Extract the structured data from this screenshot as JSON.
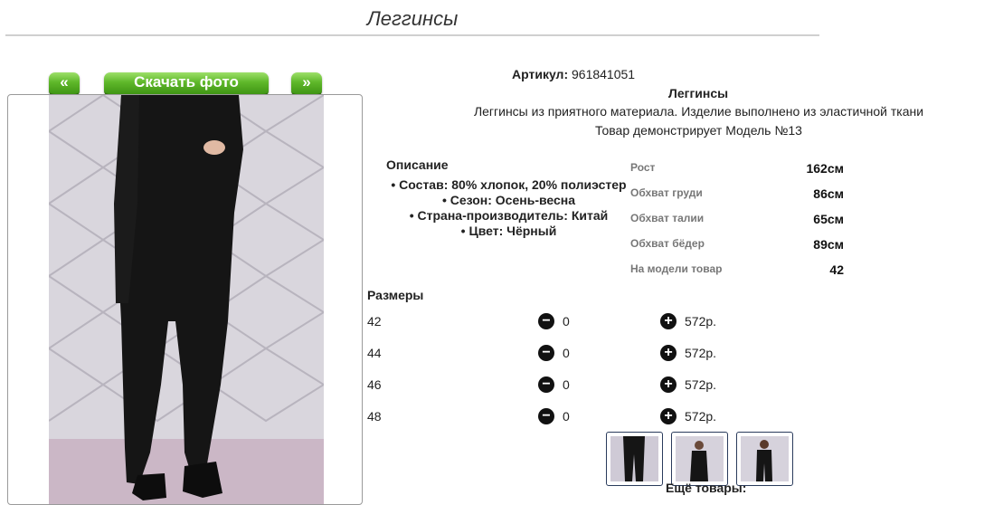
{
  "page": {
    "title": "Леггинсы"
  },
  "gallery": {
    "prev_label": "«",
    "next_label": "»",
    "download_label": "Скачать фото"
  },
  "product": {
    "article_label": "Артикул:",
    "article_value": "961841051",
    "name": "Леггинсы",
    "description": "Леггинсы из приятного материала. Изделие выполнено из эластичной ткани",
    "model_note": "Товар демонстрирует Модель №13"
  },
  "details": {
    "title": "Описание",
    "items": [
      "• Состав: 80% хлопок, 20% полиэстер",
      "• Сезон: Осень-весна",
      "• Страна-производитель: Китай",
      "• Цвет: Чёрный"
    ]
  },
  "model_measurements": [
    {
      "label": "Рост",
      "value": "162см"
    },
    {
      "label": "Обхват груди",
      "value": "86см"
    },
    {
      "label": "Обхват талии",
      "value": "65см"
    },
    {
      "label": "Обхват бёдер",
      "value": "89см"
    },
    {
      "label": "На модели товар",
      "value": "42"
    }
  ],
  "sizes": {
    "title": "Размеры",
    "rows": [
      {
        "size": "42",
        "qty": "0",
        "price": "572р."
      },
      {
        "size": "44",
        "qty": "0",
        "price": "572р."
      },
      {
        "size": "46",
        "qty": "0",
        "price": "572р."
      },
      {
        "size": "48",
        "qty": "0",
        "price": "572р."
      }
    ]
  },
  "more": {
    "title": "Ещё товары:"
  },
  "colors": {
    "button_green": "#5fb82a",
    "text": "#222222",
    "muted_label": "#777777",
    "rule": "#d0d0d0"
  }
}
